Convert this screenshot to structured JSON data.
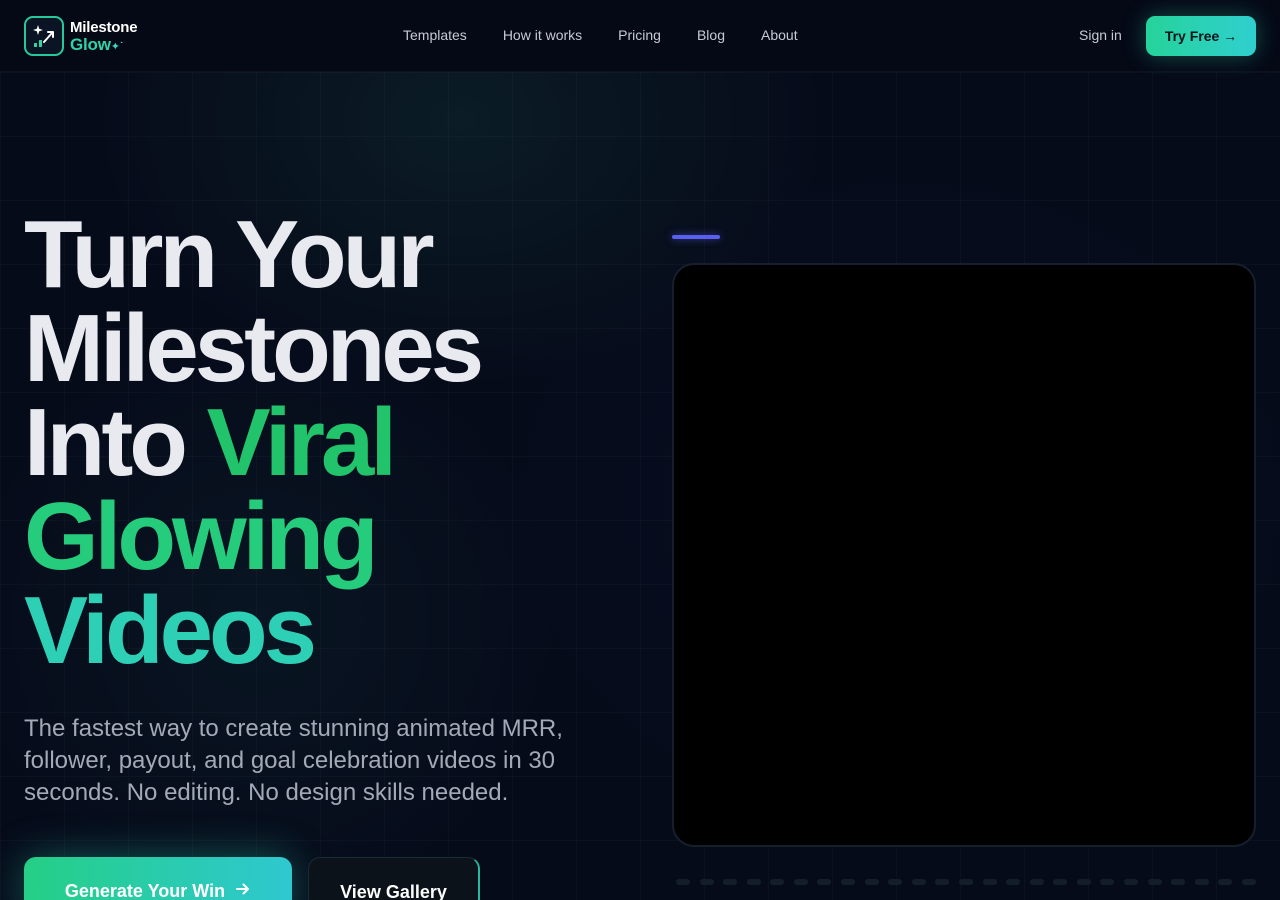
{
  "brand": {
    "name_line1": "Milestone",
    "name_line2": "Glow",
    "accent_color": "#27c99a"
  },
  "nav": {
    "links": [
      {
        "label": "Templates"
      },
      {
        "label": "How it works"
      },
      {
        "label": "Pricing"
      },
      {
        "label": "Blog"
      },
      {
        "label": "About"
      }
    ],
    "sign_in": "Sign in",
    "try_free": "Try Free →"
  },
  "hero": {
    "headline": {
      "line1": "Turn Your",
      "line2": "Milestones",
      "line3_white": "Into ",
      "line3_green": "Viral",
      "line4": "Glowing",
      "line5": "Videos"
    },
    "subtitle": "The fastest way to create stunning animated MRR, follower, payout, and goal celebration videos in 30 seconds. No editing. No design skills needed.",
    "primary_cta": "Generate Your Win",
    "primary_cta_icon": "arrow-right-icon",
    "secondary_cta": "View Gallery"
  },
  "colors": {
    "background": "#060b1a",
    "headline_white": "#e9eaf0",
    "headline_green": "#21c46a",
    "headline_teal": "#2dd0b4",
    "cta_gradient_start": "#25cf86",
    "cta_gradient_end": "#2ec8d0",
    "preview_accent": "#5b5ff0"
  }
}
